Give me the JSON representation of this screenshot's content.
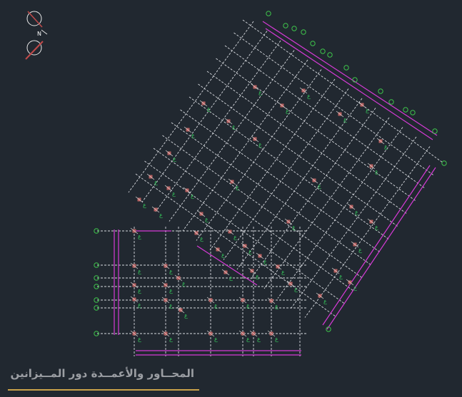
{
  "drawing": {
    "caption": "المحــاور والأعمــدة دور المــيزانين",
    "column_tag": "ع",
    "colors": {
      "background": "#212830",
      "grid": "#d8dbe0",
      "dimension": "#d63ad6",
      "axis_bubble": "#3ec44b",
      "column": "#b86060",
      "column_label": "#34c65a",
      "caption_rule": "#caa24a",
      "caption_text": "#9b9ea3"
    }
  }
}
